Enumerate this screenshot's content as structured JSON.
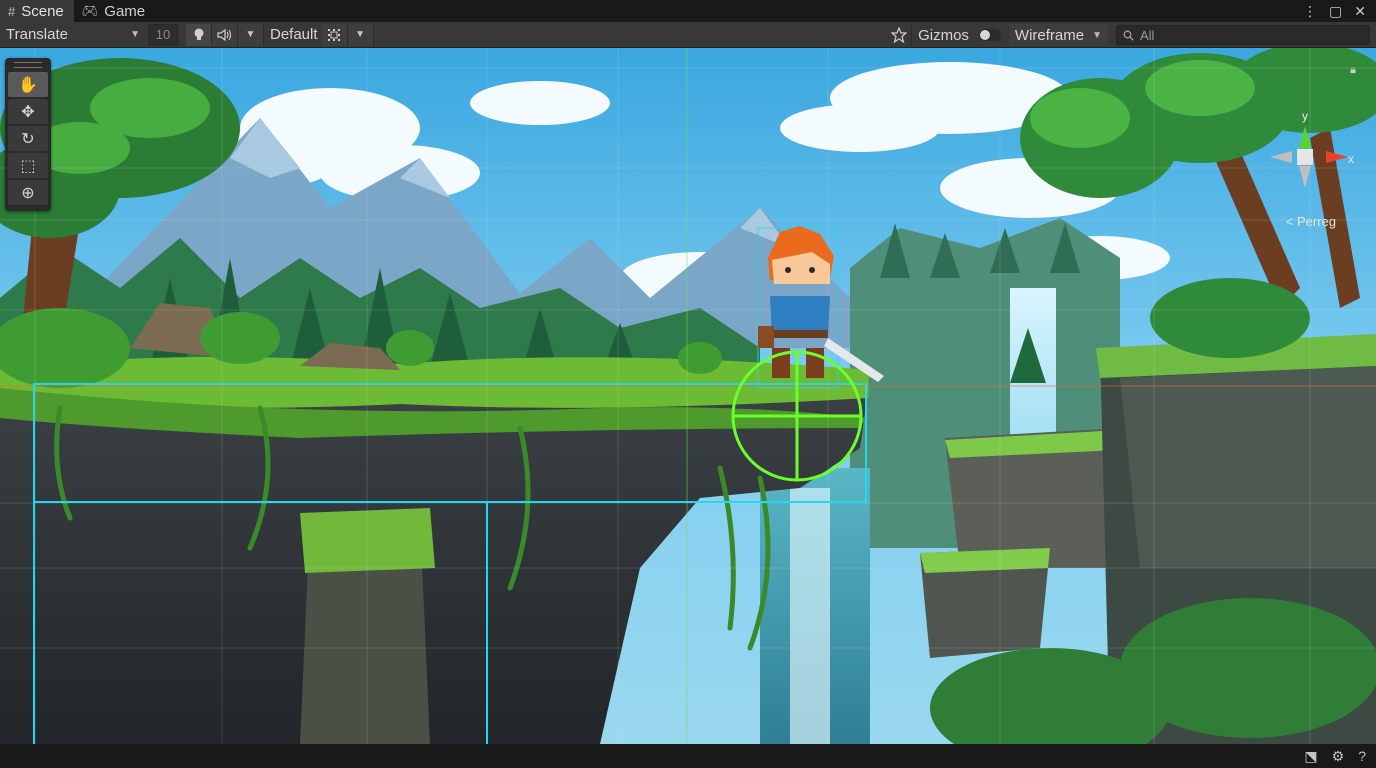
{
  "tabs": [
    {
      "label": "Scene",
      "icon": "scene-grid-icon",
      "active": true
    },
    {
      "label": "Game",
      "icon": "gamepad-icon",
      "active": false
    }
  ],
  "window_controls": {
    "more": "⋮",
    "maximize": "▢",
    "close": "✕"
  },
  "toolbar": {
    "tool_mode": "Translate",
    "snap_value": "10",
    "lighting_icon": "lightbulb-icon",
    "audio_icon": "speaker-icon",
    "layer_dropdown": "Default",
    "effects_icon": "effects-grid-icon",
    "gizmos_label": "Gizmos",
    "render_mode": "Wireframe",
    "search_placeholder": "All"
  },
  "tool_palette": [
    {
      "name": "hand-tool",
      "glyph": "✋",
      "active": true
    },
    {
      "name": "move-tool",
      "glyph": "✥",
      "active": false
    },
    {
      "name": "rotate-tool",
      "glyph": "↻",
      "active": false
    },
    {
      "name": "rect-tool",
      "glyph": "⬚",
      "active": false
    },
    {
      "name": "transform-tool",
      "glyph": "⊕",
      "active": false
    }
  ],
  "gizmo": {
    "y_label": "y",
    "x_label": "x",
    "projection": "< Perreg"
  },
  "colors": {
    "collider": "#22d8ee",
    "selection_circle": "#6bff2a",
    "axis_y": "#5bd42a",
    "axis_x": "#e8422a"
  }
}
